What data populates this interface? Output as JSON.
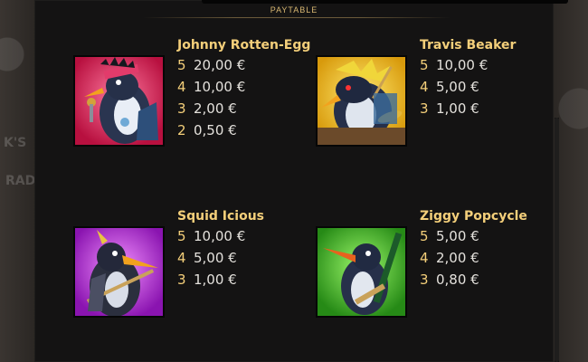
{
  "title": "PAYTABLE",
  "symbols": [
    {
      "name": "Johnny Rotten-Egg",
      "icon": "penguin-singer-icon",
      "colors": {
        "bg1": "#ff5a8a",
        "bg2": "#c0124a"
      },
      "payouts": [
        {
          "count": "5",
          "amount": "20,00 €"
        },
        {
          "count": "4",
          "amount": "10,00 €"
        },
        {
          "count": "3",
          "amount": "2,00 €"
        },
        {
          "count": "2",
          "amount": "0,50 €"
        }
      ]
    },
    {
      "name": "Travis Beaker",
      "icon": "penguin-drummer-icon",
      "colors": {
        "bg1": "#ffe25a",
        "bg2": "#e0a812"
      },
      "payouts": [
        {
          "count": "5",
          "amount": "10,00 €"
        },
        {
          "count": "4",
          "amount": "5,00 €"
        },
        {
          "count": "3",
          "amount": "1,00 €"
        }
      ]
    },
    {
      "name": "Squid Icious",
      "icon": "penguin-bassist-icon",
      "colors": {
        "bg1": "#f070ff",
        "bg2": "#a21cc8"
      },
      "payouts": [
        {
          "count": "5",
          "amount": "10,00 €"
        },
        {
          "count": "4",
          "amount": "5,00 €"
        },
        {
          "count": "3",
          "amount": "1,00 €"
        }
      ]
    },
    {
      "name": "Ziggy Popcycle",
      "icon": "penguin-guitarist-icon",
      "colors": {
        "bg1": "#8cf05a",
        "bg2": "#2f9a1c"
      },
      "payouts": [
        {
          "count": "5",
          "amount": "5,00 €"
        },
        {
          "count": "4",
          "amount": "2,00 €"
        },
        {
          "count": "3",
          "amount": "0,80 €"
        }
      ]
    }
  ]
}
